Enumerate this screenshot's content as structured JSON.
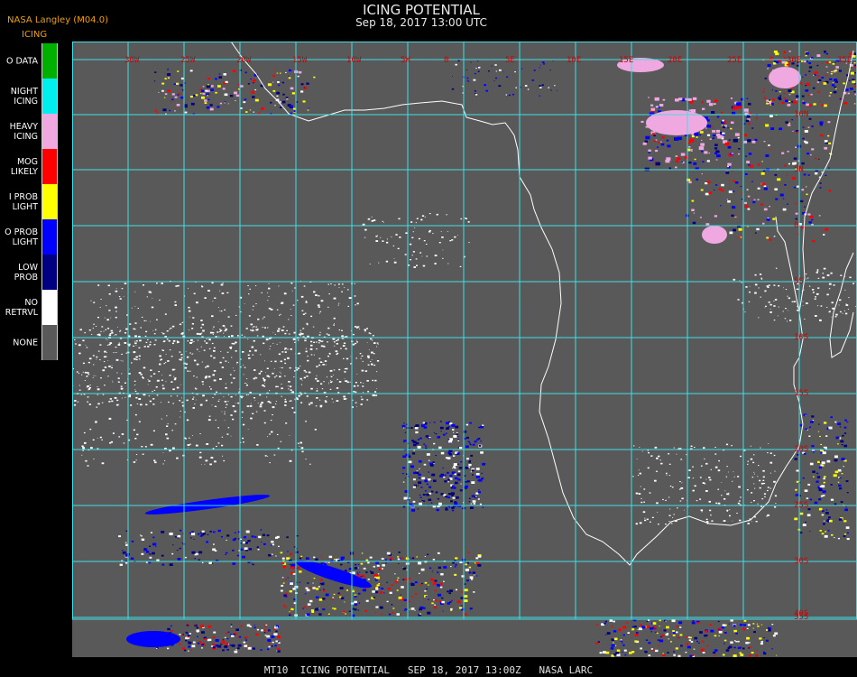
{
  "header": {
    "org": "NASA Langley (M04.0)",
    "product": "ICING",
    "title": "ICING POTENTIAL",
    "subtitle": "Sep 18, 2017 13:00 UTC"
  },
  "legend": [
    {
      "label": "O DATA",
      "color": "#00b000"
    },
    {
      "label": "NIGHT\nICING",
      "color": "#00eeee"
    },
    {
      "label": "HEAVY\nICING",
      "color": "#f0a8e0"
    },
    {
      "label": "MOG\nLIKELY",
      "color": "#ff0000"
    },
    {
      "label": "I PROB\nLIGHT",
      "color": "#ffff00"
    },
    {
      "label": "O PROB\nLIGHT",
      "color": "#0000ff"
    },
    {
      "label": "LOW\nPROB",
      "color": "#000080"
    },
    {
      "label": "NO\nRETRVL",
      "color": "#ffffff"
    },
    {
      "label": "NONE",
      "color": "#595959"
    }
  ],
  "map": {
    "background_color": "#595959",
    "grid_color": "#40e0e8",
    "coastline_color": "#ffffff",
    "label_color": "#d00000",
    "longitude_labels": [
      "30W",
      "25W",
      "20W",
      "15W",
      "10W",
      "5W",
      "0",
      "5E",
      "10E",
      "15E",
      "20E",
      "25E",
      "30E",
      "35E"
    ],
    "latitude_labels": [
      "10N",
      "5N",
      "0",
      "5S",
      "10S",
      "15S",
      "20S",
      "25S",
      "30S",
      "35S",
      "40S"
    ]
  },
  "footer": "MT10  ICING POTENTIAL   SEP 18, 2017 13:00Z   NASA LARC"
}
